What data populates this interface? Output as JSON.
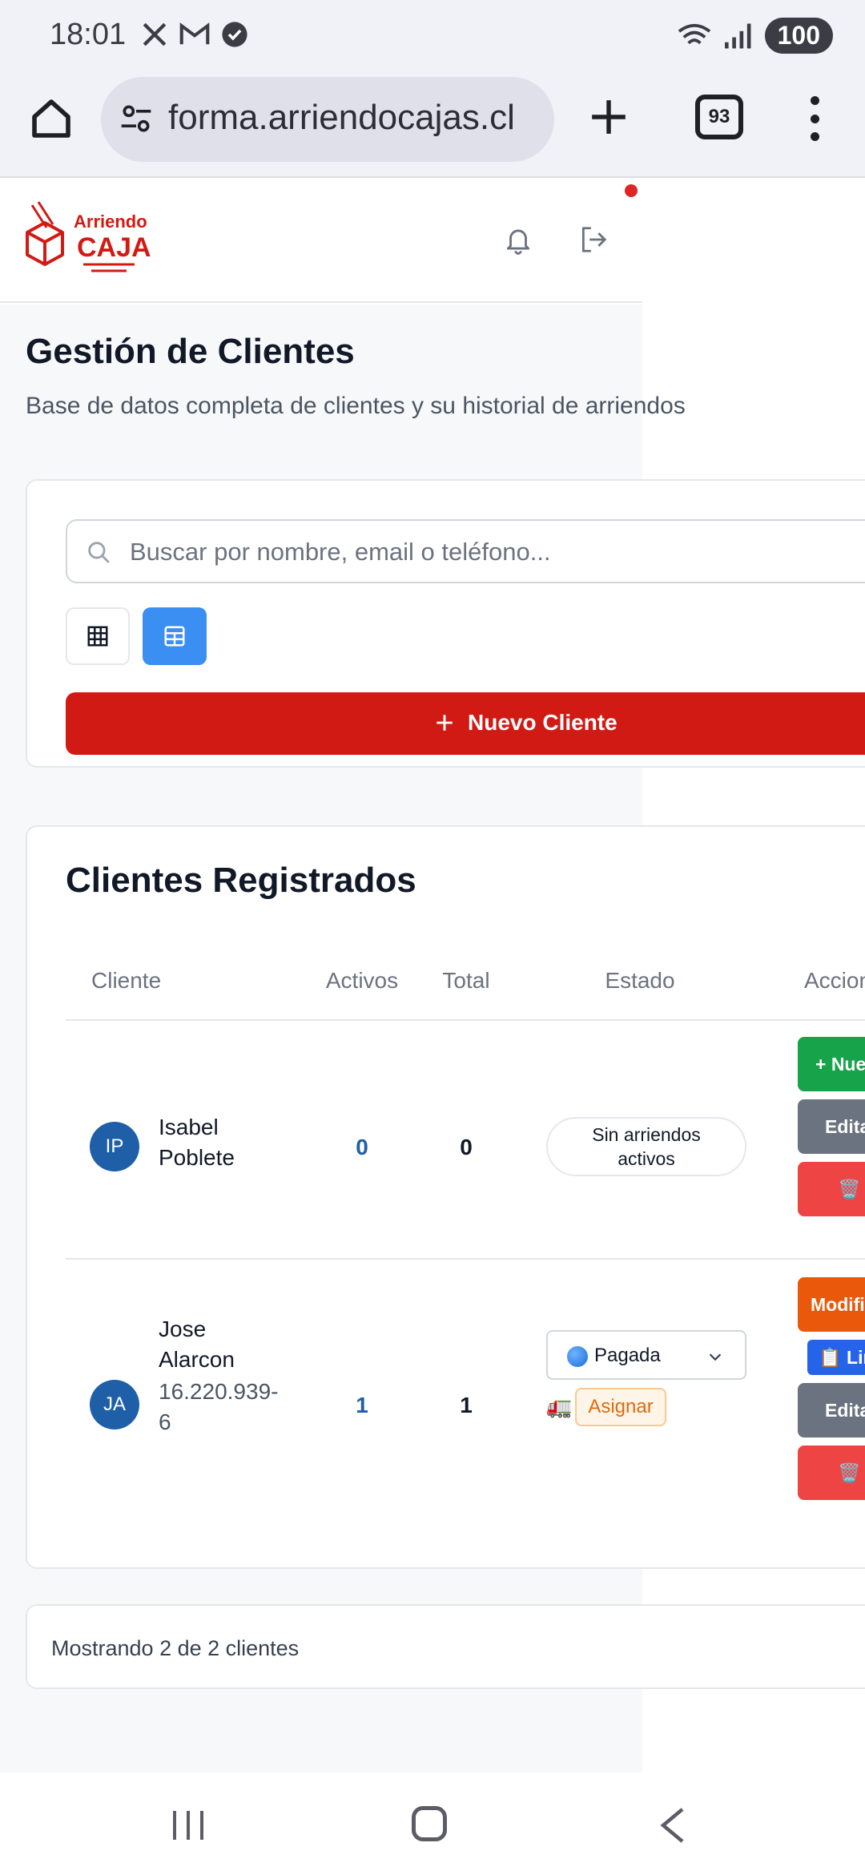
{
  "status_bar": {
    "time": "18:01",
    "battery": "100",
    "left_icons": [
      "x-icon",
      "gmail-icon",
      "check-badge-icon"
    ],
    "right_icons": [
      "wifi-icon",
      "signal-icon"
    ]
  },
  "browser": {
    "url": "forma.arriendocajas.cl",
    "tab_count": "93"
  },
  "header": {
    "logo_line1": "Arriendo",
    "logo_line2": "CAJAS"
  },
  "page": {
    "title": "Gestión de Clientes",
    "subtitle": "Base de datos completa de clientes y su historial de arriendos"
  },
  "search": {
    "placeholder": "Buscar por nombre, email o teléfono...",
    "value": ""
  },
  "new_client_label": "Nuevo Cliente",
  "clients": {
    "title": "Clientes Registrados",
    "columns": [
      "Cliente",
      "Activos",
      "Total",
      "Estado",
      "Acciones"
    ],
    "rows": [
      {
        "initials": "IP",
        "name_line1": "Isabel",
        "name_line2": "Poblete",
        "activos": "0",
        "total": "0",
        "status_line1": "Sin arriendos",
        "status_line2": "activos",
        "actions": [
          "+ Nuevo",
          "Editar",
          "🗑️"
        ]
      },
      {
        "initials": "JA",
        "name_line1": "Jose",
        "name_line2": "Alarcon",
        "rut_line1": "16.220.939-",
        "rut_line2": "6",
        "activos": "1",
        "total": "1",
        "status_select": "Pagada",
        "truck": "🚛",
        "assign_label": "Asignar",
        "actions": [
          "Modificar",
          "📋 Link",
          "Editar",
          "🗑️"
        ]
      }
    ]
  },
  "footer": {
    "text": "Mostrando 2 de 2 clientes"
  },
  "colors": {
    "brand_red": "#d21a14",
    "primary_blue": "#3b8ff3",
    "green": "#16a34a",
    "orange": "#ea580c",
    "gray": "#6b7280",
    "danger": "#ef4444"
  }
}
